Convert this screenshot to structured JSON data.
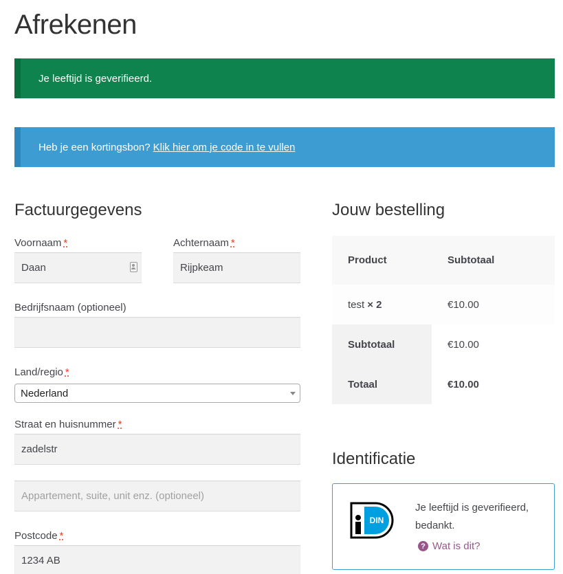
{
  "page": {
    "title": "Afrekenen"
  },
  "notices": {
    "success": "Je leeftijd is geverifieerd.",
    "coupon_prompt": "Heb je een kortingsbon?",
    "coupon_link": "Klik hier om je code in te vullen"
  },
  "billing": {
    "heading": "Factuurgegevens",
    "required_mark": "*",
    "first_name": {
      "label": "Voornaam",
      "value": "Daan"
    },
    "last_name": {
      "label": "Achternaam",
      "value": "Rijpkeam"
    },
    "company": {
      "label": "Bedrijfsnaam (optioneel)",
      "value": ""
    },
    "country": {
      "label": "Land/regio",
      "value": "Nederland"
    },
    "street": {
      "label": "Straat en huisnummer",
      "value": "zadelstr"
    },
    "address2": {
      "placeholder": "Appartement, suite, unit enz. (optioneel)"
    },
    "postcode": {
      "label": "Postcode",
      "value": "1234 AB"
    }
  },
  "order": {
    "heading": "Jouw bestelling",
    "col_product": "Product",
    "col_subtotal": "Subtotaal",
    "item_name": "test",
    "item_qty": "× 2",
    "item_total": "€10.00",
    "subtotal_label": "Subtotaal",
    "subtotal_value": "€10.00",
    "total_label": "Totaal",
    "total_value": "€10.00"
  },
  "identification": {
    "heading": "Identificatie",
    "logo_text": "DIN",
    "message": "Je leeftijd is geverifieerd, bedankt.",
    "help_icon": "question-circle-icon",
    "help_link": "Wat is dit?"
  },
  "colors": {
    "success": "#0f834d",
    "info": "#3d9cd2",
    "link": "#96588a",
    "required": "#e2401c"
  }
}
